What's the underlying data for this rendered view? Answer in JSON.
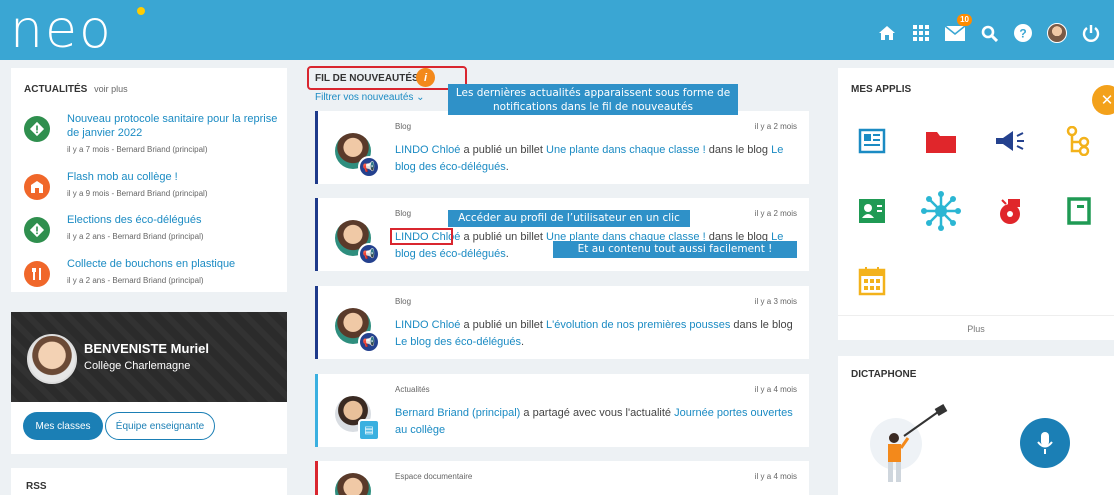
{
  "header": {
    "logo": "neo",
    "icons": [
      "home-icon",
      "apps-grid-icon",
      "mail-icon",
      "search-icon",
      "help-icon",
      "user-avatar",
      "power-icon"
    ],
    "mail_badge": "10",
    "bg_color": "#3aa6d3"
  },
  "actualites": {
    "title": "ACTUALITÉS",
    "more": "voir plus",
    "items": [
      {
        "title": "Nouveau protocole sanitaire pour la reprise de janvier 2022",
        "meta": "il y a 7 mois - Bernard Briand (principal)",
        "icon": "warning-icon",
        "color": "#2f8f4e"
      },
      {
        "title": "Flash mob au collège !",
        "meta": "il y a 9 mois - Bernard Briand (principal)",
        "icon": "school-icon",
        "color": "#f0672a"
      },
      {
        "title": "Elections des éco-délégués",
        "meta": "il y a 2 ans - Bernard Briand (principal)",
        "icon": "warning-icon",
        "color": "#2f8f4e"
      },
      {
        "title": "Collecte de bouchons en plastique",
        "meta": "il y a 2 ans - Bernard Briand (principal)",
        "icon": "cutlery-icon",
        "color": "#f0672a"
      }
    ]
  },
  "profile": {
    "name": "BENVENISTE Muriel",
    "school": "Collège Charlemagne",
    "btn_classes": "Mes classes",
    "btn_team": "Équipe enseignante"
  },
  "rss": {
    "title": "RSS"
  },
  "feed": {
    "title": "FIL DE NOUVEAUTÉS",
    "info": "i",
    "filter": "Filtrer vos nouveautés",
    "posts": [
      {
        "category": "Blog",
        "time": "il y a 2 mois",
        "author": "LINDO Chloé",
        "mid": " a publié un billet ",
        "item": "Une plante dans chaque classe !",
        "mid2": " dans le blog ",
        "target": "Le blog des éco-délégués",
        "end": "."
      },
      {
        "category": "Blog",
        "time": "il y a 2 mois",
        "author": "LINDO Chloé",
        "mid": " a publié un billet ",
        "item": "Une plante dans chaque classe !",
        "mid2": " dans le blog ",
        "target": "Le blog des éco-délégués",
        "end": "."
      },
      {
        "category": "Blog",
        "time": "il y a 3 mois",
        "author": "LINDO Chloé",
        "mid": " a publié un billet ",
        "item": "L'évolution de nos premières pousses",
        "mid2": " dans le blog ",
        "target": "Le blog des éco-délégués",
        "end": "."
      },
      {
        "category": "Actualités",
        "time": "il y a 4 mois",
        "author": "Bernard Briand (principal)",
        "mid": " a partagé avec vous l'actualité ",
        "item": "Journée portes ouvertes au collège",
        "mid2": "",
        "target": "",
        "end": ""
      },
      {
        "category": "Espace documentaire",
        "time": "il y a 4 mois"
      }
    ]
  },
  "annotations": {
    "note1": "Les dernières actualités apparaissent sous forme de notifications dans le fil de nouveautés",
    "note2": "Accéder au profil de l’utilisateur en un clic",
    "note3": "Et au contenu tout aussi facilement !"
  },
  "apps": {
    "title": "MES APPLIS",
    "more": "Plus",
    "items": [
      "newspaper-icon",
      "folder-icon",
      "megaphone-icon",
      "flowchart-icon",
      "contact-card-icon",
      "network-icon",
      "whistle-icon",
      "notebook-icon",
      "calendar-icon"
    ]
  },
  "dictaphone": {
    "title": "DICTAPHONE"
  }
}
